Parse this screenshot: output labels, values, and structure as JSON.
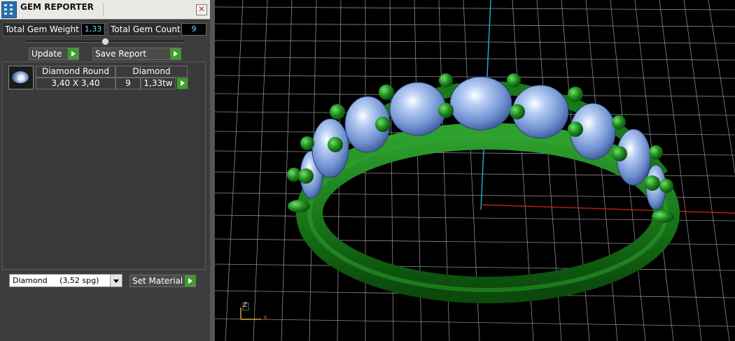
{
  "window": {
    "title": "GEM REPORTER",
    "close_glyph": "✕"
  },
  "summary": {
    "weight_label": "Total Gem Weight",
    "weight_value": "1,33",
    "count_label": "Total Gem Count",
    "count_value": "9"
  },
  "toolbar": {
    "update_label": "Update",
    "save_label": "Save Report"
  },
  "gems": [
    {
      "name": "Diamond Round",
      "material": "Diamond",
      "size": "3,40 X 3,40",
      "count": "9",
      "weight": "1,33tw"
    }
  ],
  "footer": {
    "material_select": "Diamond     (3,52 spg)",
    "set_material_label": "Set Material"
  },
  "viewport": {
    "axis_labels": {
      "z": "Z",
      "x": "X"
    },
    "colors": {
      "background": "#000000",
      "grid": "#8a8a8a",
      "y_axis": "#23b4c8",
      "x_axis": "#c0201c",
      "ring": "#1f7a1f",
      "stone": "#8fb0e8"
    }
  }
}
